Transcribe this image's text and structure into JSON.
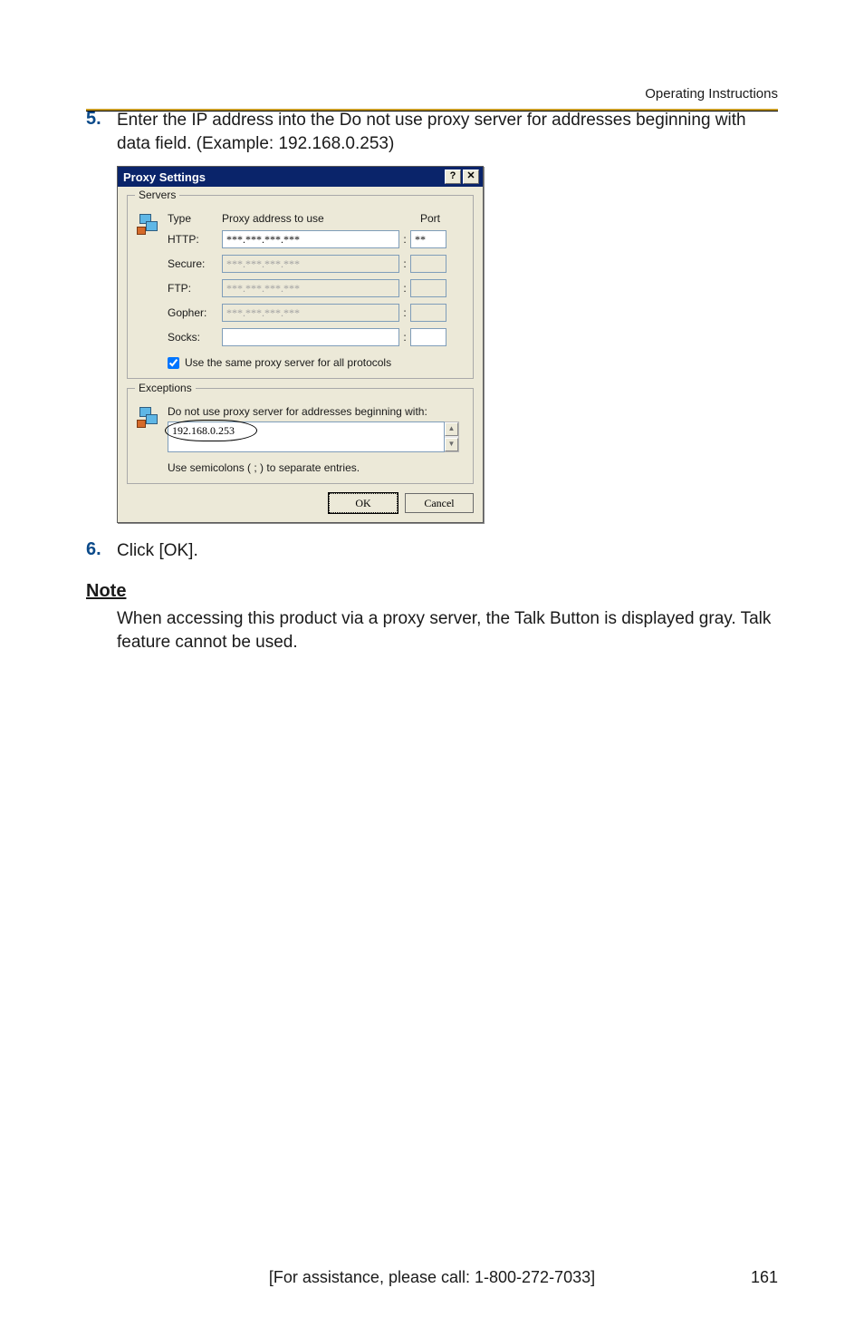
{
  "header": {
    "section_label": "Operating Instructions"
  },
  "steps": {
    "s5": {
      "num": "5.",
      "text": "Enter the IP address into the Do not use proxy server for addresses beginning with data field. (Example: 192.168.0.253)"
    },
    "s6": {
      "num": "6.",
      "text": "Click [OK]."
    }
  },
  "note": {
    "heading": "Note",
    "body": "When accessing this product via a proxy server, the Talk Button is displayed gray. Talk feature cannot be used."
  },
  "dialog": {
    "title": "Proxy Settings",
    "help_glyph": "?",
    "close_glyph": "✕",
    "groups": {
      "servers": {
        "label": "Servers",
        "columns": {
          "type": "Type",
          "addr": "Proxy address to use",
          "port": "Port"
        },
        "rows": {
          "http": {
            "label": "HTTP:",
            "addr": "***.***.***.***",
            "port": "**",
            "enabled": true
          },
          "secure": {
            "label": "Secure:",
            "addr": "***.***.***.***",
            "port": "",
            "enabled": false
          },
          "ftp": {
            "label": "FTP:",
            "addr": "***.***.***.***",
            "port": "",
            "enabled": false
          },
          "gopher": {
            "label": "Gopher:",
            "addr": "***.***.***.***",
            "port": "",
            "enabled": false
          },
          "socks": {
            "label": "Socks:",
            "addr": "",
            "port": "",
            "enabled": true
          }
        },
        "checkbox_label": "Use the same proxy server for all protocols",
        "checkbox_checked": true
      },
      "exceptions": {
        "label": "Exceptions",
        "instruction": "Do not use proxy server for addresses beginning with:",
        "value": "192.168.0.253",
        "hint": "Use semicolons ( ; ) to separate entries."
      }
    },
    "buttons": {
      "ok": "OK",
      "cancel": "Cancel"
    }
  },
  "footer": {
    "assist": "[For assistance, please call: 1-800-272-7033]",
    "page": "161"
  }
}
